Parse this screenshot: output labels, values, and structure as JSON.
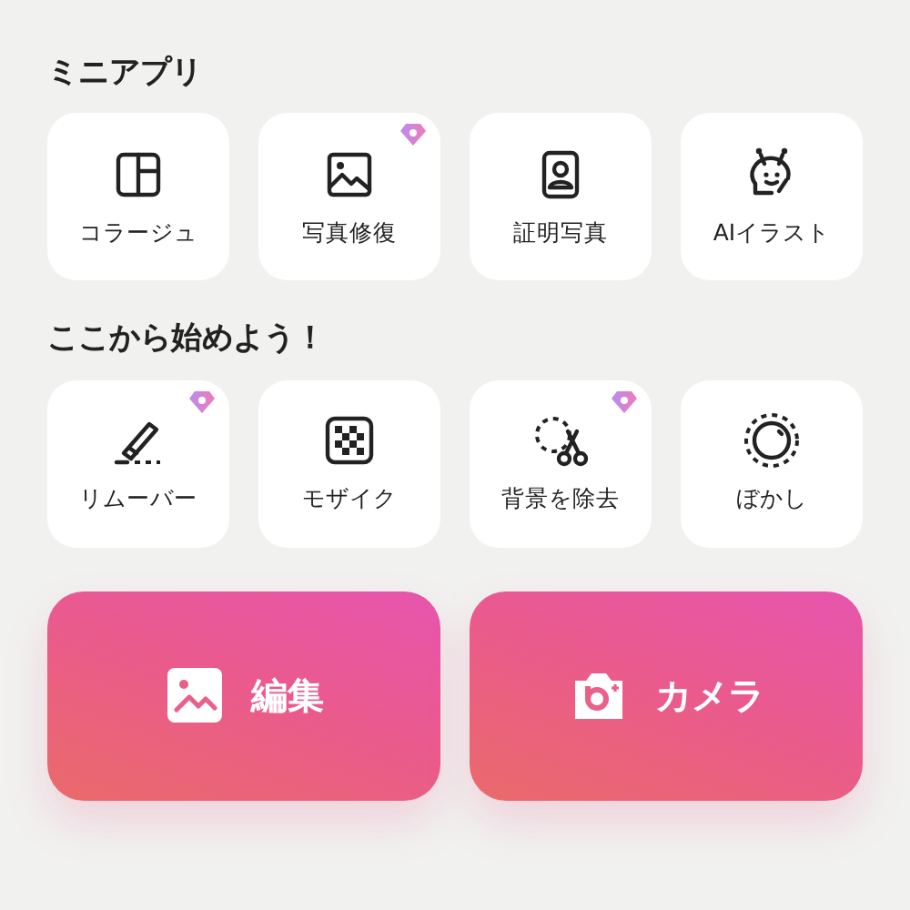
{
  "sections": [
    {
      "title": "ミニアプリ",
      "items": [
        {
          "label": "コラージュ",
          "kind": "collage",
          "premium": false
        },
        {
          "label": "写真修復",
          "kind": "photo",
          "premium": true
        },
        {
          "label": "証明写真",
          "kind": "portrait",
          "premium": false
        },
        {
          "label": "AIイラスト",
          "kind": "robot",
          "premium": false
        }
      ]
    },
    {
      "title": "ここから始めよう！",
      "items": [
        {
          "label": "リムーバー",
          "kind": "eraser",
          "premium": true
        },
        {
          "label": "モザイク",
          "kind": "mosaic",
          "premium": false
        },
        {
          "label": "背景を除去",
          "kind": "cutout",
          "premium": true
        },
        {
          "label": "ぼかし",
          "kind": "blur",
          "premium": false
        }
      ]
    }
  ],
  "actions": [
    {
      "label": "編集",
      "kind": "image"
    },
    {
      "label": "カメラ",
      "kind": "camera"
    }
  ]
}
